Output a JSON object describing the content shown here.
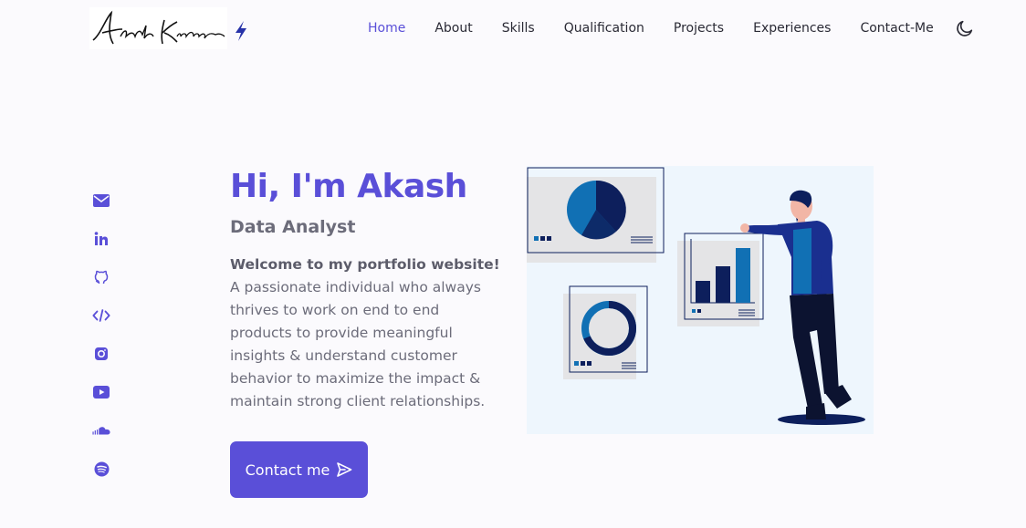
{
  "header": {
    "logo_text": "Akash Kumar",
    "nav": [
      {
        "label": "Home",
        "active": true
      },
      {
        "label": "About",
        "active": false
      },
      {
        "label": "Skills",
        "active": false
      },
      {
        "label": "Qualification",
        "active": false
      },
      {
        "label": "Projects",
        "active": false
      },
      {
        "label": "Experiences",
        "active": false
      },
      {
        "label": "Contact-Me",
        "active": false
      }
    ],
    "theme_icon": "moon-icon"
  },
  "social": [
    {
      "icon": "mail-icon"
    },
    {
      "icon": "linkedin-icon"
    },
    {
      "icon": "github-icon"
    },
    {
      "icon": "code-icon"
    },
    {
      "icon": "instagram-icon"
    },
    {
      "icon": "youtube-icon"
    },
    {
      "icon": "soundcloud-icon"
    },
    {
      "icon": "spotify-icon"
    }
  ],
  "hero": {
    "title": "Hi, I'm Akash",
    "subtitle": "Data Analyst",
    "welcome": "Welcome to my portfolio website!",
    "description": "A passionate individual who always thrives to work on end to end products to provide meaningful insights & understand customer behavior to maximize the impact & maintain strong client relationships.",
    "cta_label": "Contact me"
  },
  "colors": {
    "accent": "#5a4fd8",
    "navy": "#0d1f5c",
    "chart_blue": "#1170b4"
  }
}
